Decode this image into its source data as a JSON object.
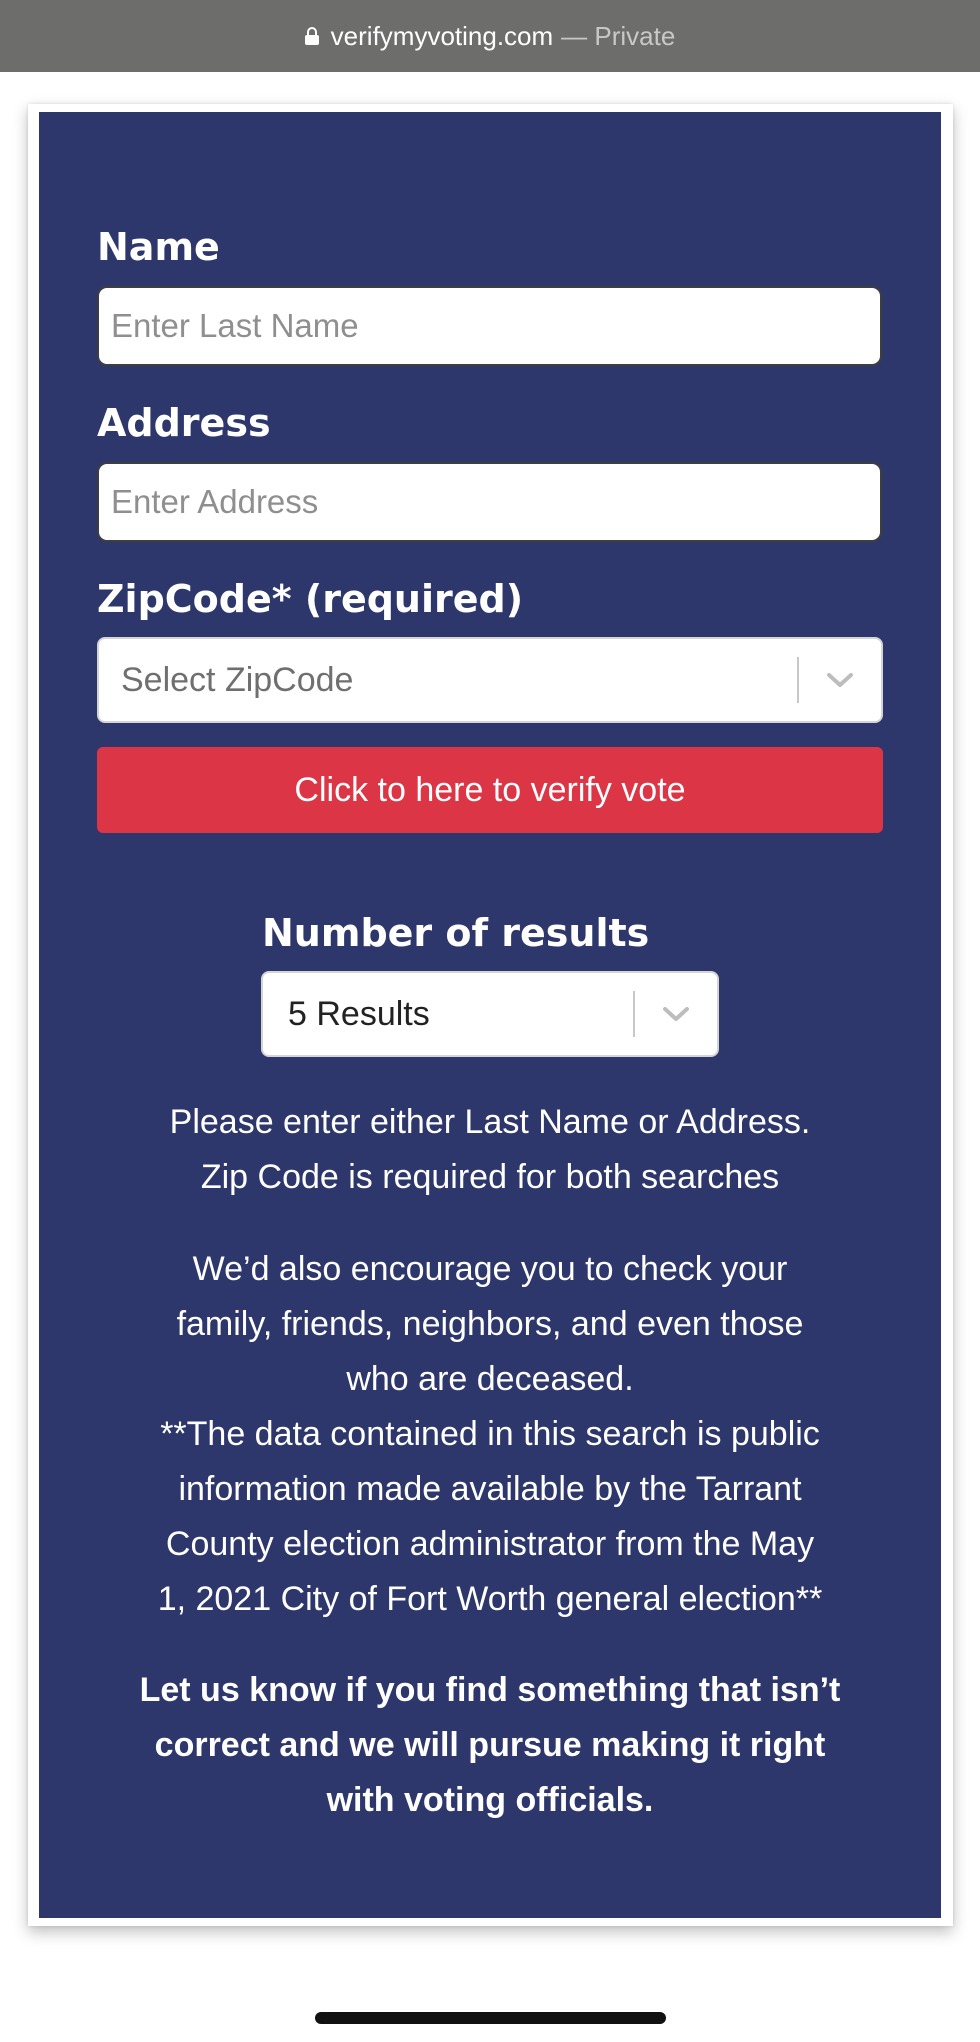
{
  "browser": {
    "domain": "verifymyvoting.com",
    "separator": "—",
    "mode": "Private"
  },
  "form": {
    "name_label": "Name",
    "name_placeholder": "Enter Last Name",
    "address_label": "Address",
    "address_placeholder": "Enter Address",
    "zip_label": "ZipCode* (required)",
    "zip_placeholder": "Select ZipCode",
    "verify_button": "Click to here to verify vote",
    "results_label": "Number of results",
    "results_value": "5 Results"
  },
  "info": {
    "line1": "Please enter either Last Name or Address.",
    "line2": "Zip Code is required for both searches",
    "encourage1": "We’d also encourage you to check your",
    "encourage2": "family, friends, neighbors, and even those",
    "encourage3": "who are deceased.",
    "data1": "**The data contained in this search is public",
    "data2": "information made available by the Tarrant",
    "data3": "County election administrator from the May",
    "data4": "1, 2021 City of Fort Worth general election**",
    "cta1": "Let us know if you find something that isn’t",
    "cta2": "correct and we will pursue making it right",
    "cta3": "with voting officials."
  },
  "colors": {
    "panel": "#2d376b",
    "button": "#dc3545",
    "url_bar": "#6d6d6b"
  },
  "icons": {
    "lock": "lock-icon",
    "chevron": "chevron-down-icon"
  }
}
